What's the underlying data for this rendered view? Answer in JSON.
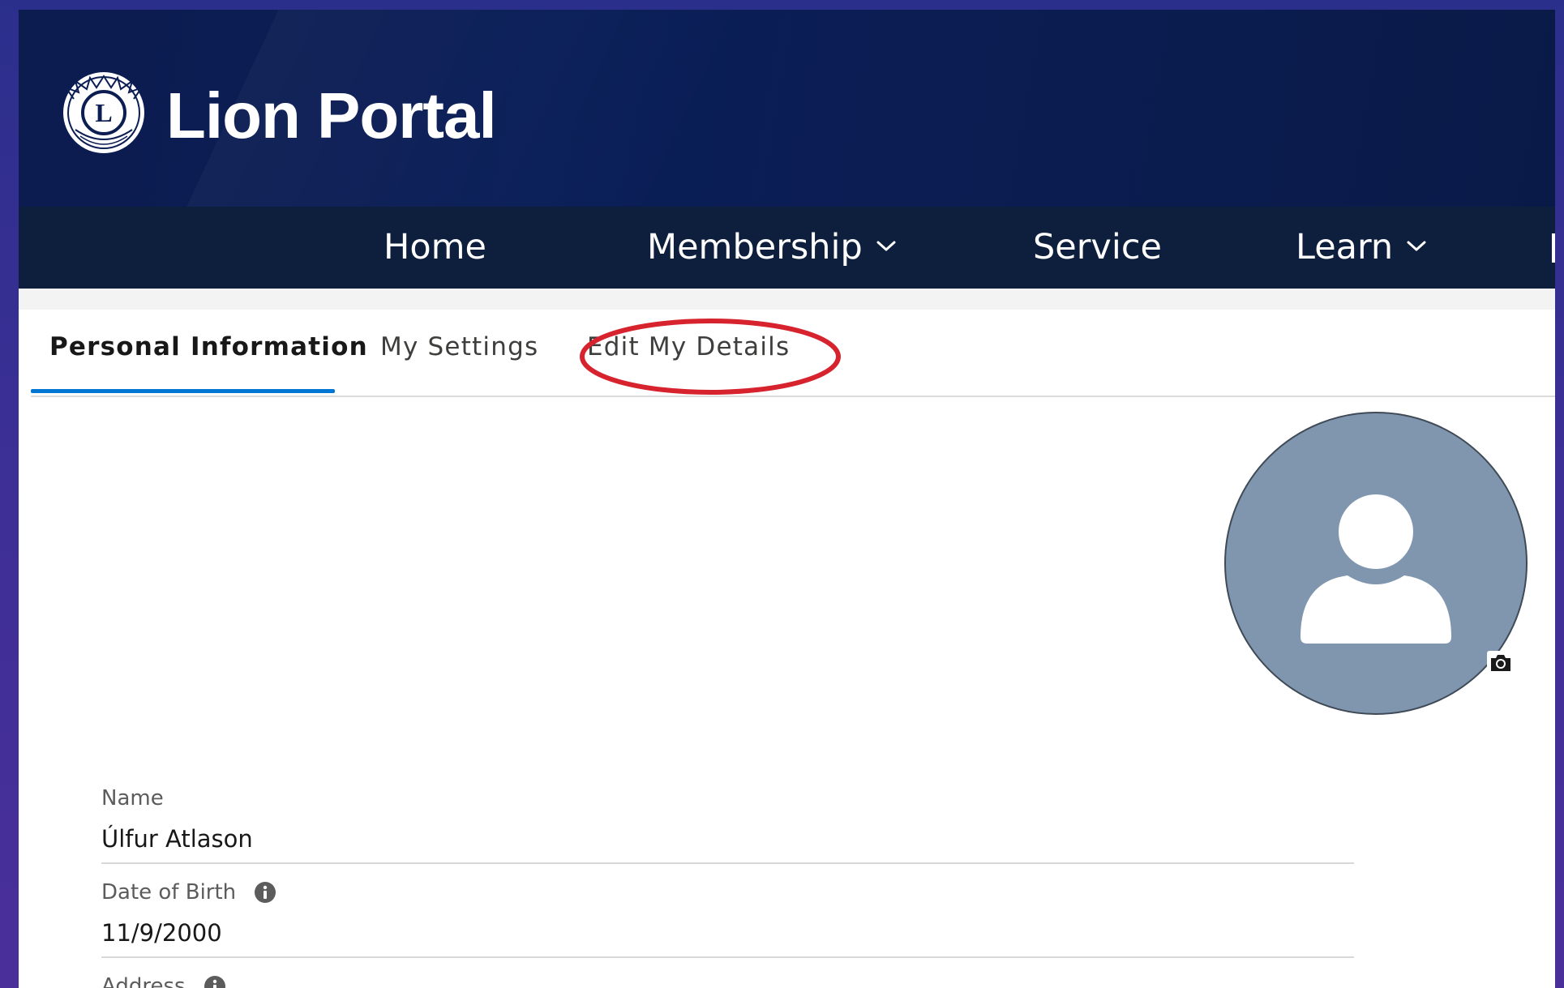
{
  "brand": {
    "title": "Lion Portal",
    "logo_icon": "lions-international-emblem-icon"
  },
  "nav": {
    "items": [
      {
        "label": "Home",
        "has_dropdown": false
      },
      {
        "label": "Membership",
        "has_dropdown": true
      },
      {
        "label": "Service",
        "has_dropdown": false
      },
      {
        "label": "Learn",
        "has_dropdown": true
      }
    ]
  },
  "tabs": {
    "items": [
      {
        "label": "Personal Information",
        "active": true
      },
      {
        "label": "My Settings",
        "active": false
      },
      {
        "label": "Edit My Details",
        "active": false,
        "highlighted": true
      }
    ]
  },
  "profile": {
    "avatar_icon": "user-silhouette-icon",
    "camera_icon": "camera-icon",
    "fields": [
      {
        "label": "Name",
        "value": "Úlfur Atlason",
        "has_info": false
      },
      {
        "label": "Date of Birth",
        "value": "11/9/2000",
        "has_info": true
      },
      {
        "label": "Address",
        "value": "",
        "has_info": true
      }
    ]
  },
  "colors": {
    "banner": "#0b1d52",
    "navbar": "#0d1f3c",
    "active_tab_underline": "#0176d3",
    "highlight_ellipse": "#d6232e",
    "avatar_bg": "#7f96ae",
    "background_outer": "#3b2f93"
  }
}
